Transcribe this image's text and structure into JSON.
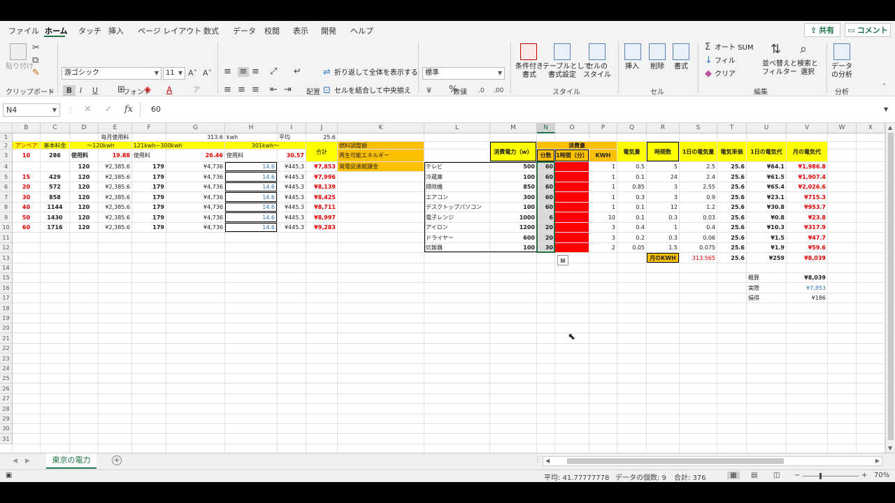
{
  "menu_tabs": [
    "ファイル",
    "ホーム",
    "タッチ",
    "挿入",
    "ページ レイアウト",
    "数式",
    "データ",
    "校閲",
    "表示",
    "開発",
    "ヘルプ"
  ],
  "share_label": "共有",
  "comment_label": "コメント",
  "ribbon": {
    "paste": "貼り付け",
    "font_name": "游ゴシック",
    "font_size": "11",
    "wrap_text": "折り返して全体を表示する",
    "merge_center": "セルを結合して中央揃え",
    "number_format": "標準",
    "cond_format": [
      "条件付き",
      "書式"
    ],
    "table_format": [
      "テーブルとして",
      "書式設定"
    ],
    "cell_style": [
      "セルの",
      "スタイル"
    ],
    "insert": "挿入",
    "delete": "削除",
    "format": "書式",
    "autosum": "オート SUM",
    "fill": "フィル",
    "clear": "クリア",
    "sort_filter": [
      "並べ替えと",
      "フィルター"
    ],
    "find_select": [
      "検索と",
      "選択"
    ],
    "data_analysis": [
      "データ",
      "の分析"
    ],
    "groups": {
      "clipboard": "クリップボード",
      "font": "フォント",
      "alignment": "配置",
      "number": "数値",
      "styles": "スタイル",
      "cells": "セル",
      "editing": "編集",
      "analysis": "分析"
    }
  },
  "formula_bar": {
    "name_box": "N4",
    "fx": "fx",
    "value": "60"
  },
  "sheet": {
    "col_headers": [
      "B",
      "C",
      "D",
      "E",
      "F",
      "G",
      "H",
      "I",
      "J",
      "K",
      "L",
      "M",
      "N",
      "O",
      "P",
      "Q",
      "R",
      "S",
      "T",
      "U",
      "V",
      "W",
      "X"
    ],
    "row_headers": [
      "1",
      "2",
      "3",
      "4",
      "5",
      "6",
      "7",
      "8",
      "9",
      "10",
      "11",
      "12",
      "13",
      "14",
      "15",
      "16",
      "17",
      "18",
      "19",
      "20",
      "21",
      "22",
      "23",
      "24",
      "25",
      "26",
      "27",
      "28",
      "29",
      "30",
      "31"
    ],
    "left": {
      "monthly_label": "毎月使用料",
      "monthly_value": "313.6",
      "kwh_unit": "kwh",
      "avg_label": "平均",
      "avg_value": "25.6",
      "ampere": "アンペア",
      "base_fee": "基本料金",
      "tier1": "～120kwh",
      "tier2": "121kwh~300kwh",
      "tier3": "301kwh～",
      "usage": "使用料",
      "rate1": "19.88",
      "rate2": "26.46",
      "rate3": "30.57",
      "total": "合計",
      "adjust": "燃料調整額",
      "renewable": "再生可能エネルギー",
      "renewable2": "発電促進賦課金",
      "row3_amp": "10",
      "row3_base": "286",
      "rows": [
        {
          "amp": "",
          "base": "",
          "d": "120",
          "e": "¥2,385.6",
          "f": "179",
          "g": "¥4,736",
          "h": "14.6",
          "i": "¥445.3",
          "j": "¥7,853"
        },
        {
          "amp": "15",
          "base": "429",
          "d": "120",
          "e": "¥2,385.6",
          "f": "179",
          "g": "¥4,736",
          "h": "14.6",
          "i": "¥445.3",
          "j": "¥7,996"
        },
        {
          "amp": "20",
          "base": "572",
          "d": "120",
          "e": "¥2,385.6",
          "f": "179",
          "g": "¥4,736",
          "h": "14.6",
          "i": "¥445.3",
          "j": "¥8,139"
        },
        {
          "amp": "30",
          "base": "858",
          "d": "120",
          "e": "¥2,385.6",
          "f": "179",
          "g": "¥4,736",
          "h": "14.6",
          "i": "¥445.3",
          "j": "¥8,425"
        },
        {
          "amp": "40",
          "base": "1144",
          "d": "120",
          "e": "¥2,385.6",
          "f": "179",
          "g": "¥4,736",
          "h": "14.6",
          "i": "¥445.3",
          "j": "¥8,711"
        },
        {
          "amp": "50",
          "base": "1430",
          "d": "120",
          "e": "¥2,385.6",
          "f": "179",
          "g": "¥4,736",
          "h": "14.6",
          "i": "¥445.3",
          "j": "¥8,997"
        },
        {
          "amp": "60",
          "base": "1716",
          "d": "120",
          "e": "¥2,385.6",
          "f": "179",
          "g": "¥4,736",
          "h": "14.6",
          "i": "¥445.3",
          "j": "¥9,283"
        }
      ]
    },
    "right": {
      "consumption_header": "消費量",
      "power_header": "消費電力（w）",
      "minutes": "分数",
      "per_hour": "1時間（分）",
      "kwh": "KWH",
      "electricity": "電気量",
      "hours": "時間数",
      "daily_kwh": "1日の電気量",
      "unit_price": "電気単価",
      "daily_cost": "1日の電気代",
      "monthly_cost": "月の電気代",
      "rows": [
        {
          "name": "テレビ",
          "w": "500",
          "min": "60",
          "kwh": "1",
          "elec": "0.5",
          "hrs": "5",
          "daily": "2.5",
          "price": "25.6",
          "dcost": "¥64.1",
          "mcost": "¥1,986.8"
        },
        {
          "name": "冷蔵庫",
          "w": "100",
          "min": "60",
          "kwh": "1",
          "elec": "0.1",
          "hrs": "24",
          "daily": "2.4",
          "price": "25.6",
          "dcost": "¥61.5",
          "mcost": "¥1,907.4"
        },
        {
          "name": "掃除機",
          "w": "850",
          "min": "60",
          "kwh": "1",
          "elec": "0.85",
          "hrs": "3",
          "daily": "2.55",
          "price": "25.6",
          "dcost": "¥65.4",
          "mcost": "¥2,026.6"
        },
        {
          "name": "エアコン",
          "w": "300",
          "min": "60",
          "kwh": "1",
          "elec": "0.3",
          "hrs": "3",
          "daily": "0.9",
          "price": "25.6",
          "dcost": "¥23.1",
          "mcost": "¥715.3"
        },
        {
          "name": "デスクトップパソコン",
          "w": "100",
          "min": "60",
          "kwh": "1",
          "elec": "0.1",
          "hrs": "12",
          "daily": "1.2",
          "price": "25.6",
          "dcost": "¥30.8",
          "mcost": "¥953.7"
        },
        {
          "name": "電子レンジ",
          "w": "1000",
          "min": "6",
          "kwh": "10",
          "elec": "0.1",
          "hrs": "0.3",
          "daily": "0.03",
          "price": "25.6",
          "dcost": "¥0.8",
          "mcost": "¥23.8"
        },
        {
          "name": "アイロン",
          "w": "1200",
          "min": "20",
          "kwh": "3",
          "elec": "0.4",
          "hrs": "1",
          "daily": "0.4",
          "price": "25.6",
          "dcost": "¥10.3",
          "mcost": "¥317.9"
        },
        {
          "name": "ドライヤー",
          "w": "600",
          "min": "20",
          "kwh": "3",
          "elec": "0.2",
          "hrs": "0.3",
          "daily": "0.06",
          "price": "25.6",
          "dcost": "¥1.5",
          "mcost": "¥47.7"
        },
        {
          "name": "炊飯器",
          "w": "100",
          "min": "30",
          "kwh": "2",
          "elec": "0.05",
          "hrs": "1.5",
          "daily": "0.075",
          "price": "25.6",
          "dcost": "¥1.9",
          "mcost": "¥59.6"
        }
      ],
      "monthly_kwh_label": "月のKWH",
      "monthly_kwh": "313.565",
      "monthly_price": "25.6",
      "monthly_daily": "¥259",
      "monthly_total": "¥8,039",
      "estimate_label": "概算",
      "estimate": "¥8,039",
      "actual_label": "実際",
      "actual": "¥7,853",
      "diff_label": "損得",
      "diff": "¥186"
    }
  },
  "sheet_tab": "東京の電力",
  "status": {
    "average": "平均: 41.77777778",
    "count": "データの個数: 9",
    "sum": "合計: 376",
    "zoom": "70%"
  },
  "colors": {
    "accent": "#217346",
    "yellow": "#ffff00",
    "orange": "#ffc000",
    "red": "#ff0000"
  }
}
